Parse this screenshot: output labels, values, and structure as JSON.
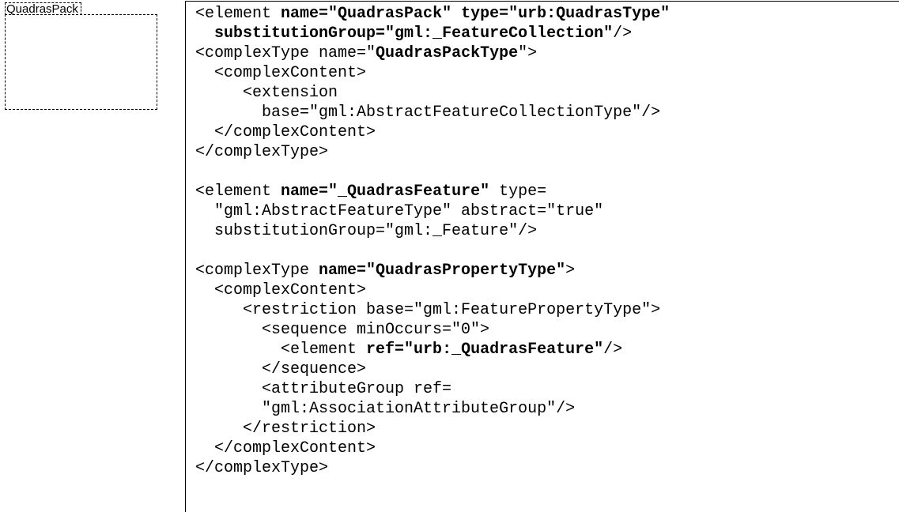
{
  "package": {
    "label": "QuadrasPack"
  },
  "code": {
    "lines": [
      [
        {
          "t": "<element "
        },
        {
          "t": "name=\"QuadrasPack\" type=\"urb:QuadrasType\"",
          "b": true
        }
      ],
      [
        {
          "t": "  "
        },
        {
          "t": "substitutionGroup=\"gml:_FeatureCollection\"",
          "b": true
        },
        {
          "t": "/>"
        }
      ],
      [
        {
          "t": "<complexType name=\""
        },
        {
          "t": "QuadrasPackType",
          "b": true
        },
        {
          "t": "\">"
        }
      ],
      [
        {
          "t": "  <complexContent>"
        }
      ],
      [
        {
          "t": "     <extension"
        }
      ],
      [
        {
          "t": "       base=\"gml:AbstractFeatureCollectionType\"/>"
        }
      ],
      [
        {
          "t": "  </complexContent>"
        }
      ],
      [
        {
          "t": "</complexType>"
        }
      ],
      [
        {
          "t": ""
        }
      ],
      [
        {
          "t": "<element "
        },
        {
          "t": "name=\"_QuadrasFeature\"",
          "b": true
        },
        {
          "t": " type="
        }
      ],
      [
        {
          "t": "  \"gml:AbstractFeatureType\" abstract=\"true\""
        }
      ],
      [
        {
          "t": "  substitutionGroup=\"gml:_Feature\"/>"
        }
      ],
      [
        {
          "t": ""
        }
      ],
      [
        {
          "t": "<complexType "
        },
        {
          "t": "name=\"QuadrasPropertyType\"",
          "b": true
        },
        {
          "t": ">"
        }
      ],
      [
        {
          "t": "  <complexContent>"
        }
      ],
      [
        {
          "t": "     <restriction base=\"gml:FeaturePropertyType\">"
        }
      ],
      [
        {
          "t": "       <sequence minOccurs=\"0\">"
        }
      ],
      [
        {
          "t": "         <element "
        },
        {
          "t": "ref=\"urb:_QuadrasFeature\"",
          "b": true
        },
        {
          "t": "/>"
        }
      ],
      [
        {
          "t": "       </sequence>"
        }
      ],
      [
        {
          "t": "       <attributeGroup ref="
        }
      ],
      [
        {
          "t": "       \"gml:AssociationAttributeGroup\"/>"
        }
      ],
      [
        {
          "t": "     </restriction>"
        }
      ],
      [
        {
          "t": "  </complexContent>"
        }
      ],
      [
        {
          "t": "</complexType>"
        }
      ]
    ]
  }
}
